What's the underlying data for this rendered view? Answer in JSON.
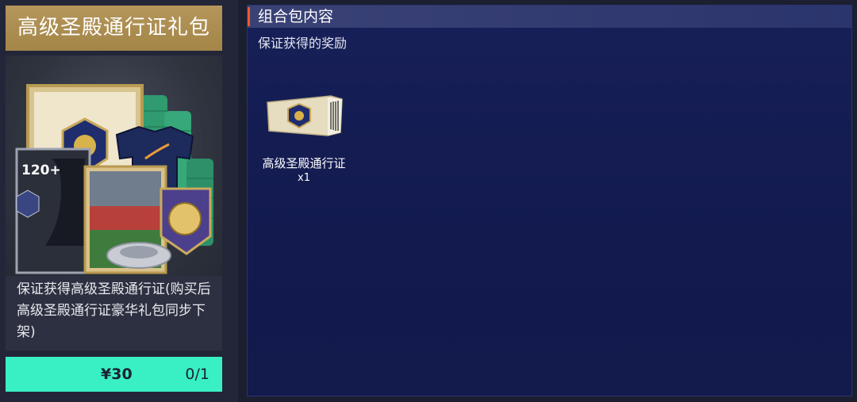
{
  "pack": {
    "title": "高级圣殿通行证礼包",
    "art_badge": "120+",
    "description": "保证获得高级圣殿通行证(购买后高级圣殿通行证豪华礼包同步下架)",
    "price": "¥30",
    "purchase_count": "0/1"
  },
  "contents": {
    "header": "组合包内容",
    "section_title": "保证获得的奖励",
    "items": [
      {
        "name": "高级圣殿通行证",
        "qty": "x1",
        "icon": "ticket-icon"
      }
    ]
  },
  "colors": {
    "title_gold": "#b5965a",
    "buy_button": "#39f0c4",
    "panel_navy": "#131a4c",
    "accent_orange": "#f05a2a"
  }
}
